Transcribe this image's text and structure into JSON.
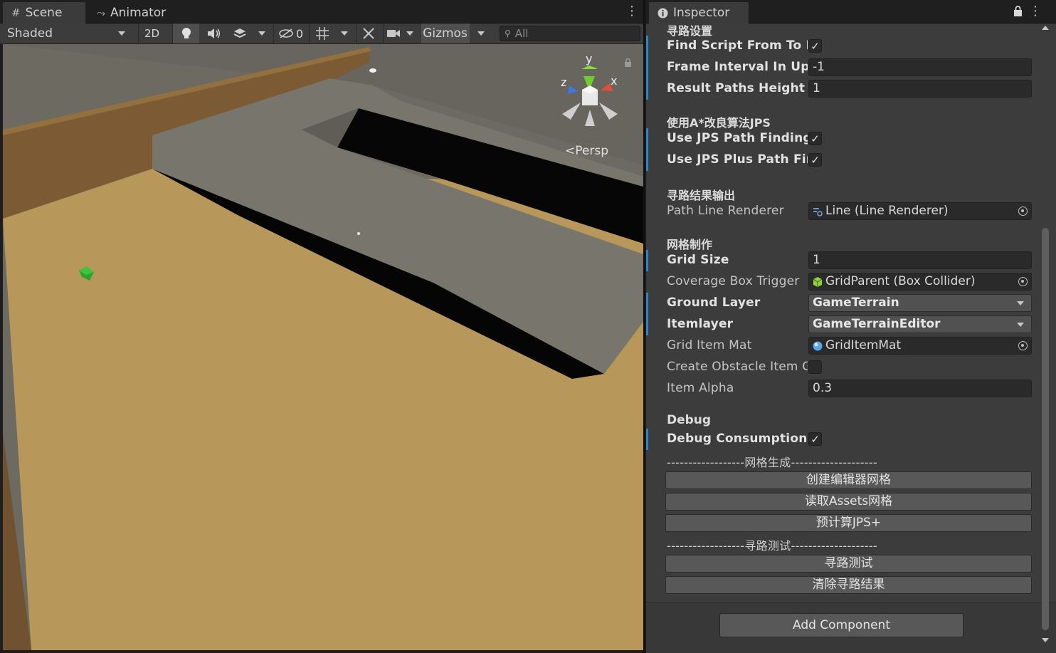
{
  "scene": {
    "tabs": [
      {
        "label": "Scene",
        "icon": "hash-icon"
      },
      {
        "label": "Animator",
        "icon": "animator-icon"
      }
    ],
    "toolbar": {
      "shading_mode": "Shaded",
      "mode_2d": "2D",
      "hidden_count": "0",
      "gizmos_label": "Gizmos",
      "search_placeholder": "All"
    },
    "gizmo": {
      "y": "y",
      "x": "x",
      "z": "z",
      "projection": "Persp"
    }
  },
  "inspector": {
    "tab_label": "Inspector",
    "sections": {
      "pathfinding_settings": "寻路设置",
      "jps": "使用A*改良算法JPS",
      "result_output": "寻路结果输出",
      "grid_making": "网格制作",
      "debug": "Debug"
    },
    "fields": {
      "find_script_label": "Find Script From To In",
      "frame_interval_label": "Frame Interval In Update",
      "frame_interval_value": "-1",
      "result_height_label": "Result Paths Height Offset",
      "result_height_value": "1",
      "use_jps_label": "Use JPS Path Finding",
      "use_jps_plus_label": "Use JPS Plus Path Finding",
      "path_line_renderer_label": "Path Line Renderer",
      "path_line_renderer_value": "Line (Line Renderer)",
      "grid_size_label": "Grid Size",
      "grid_size_value": "1",
      "coverage_box_label": "Coverage Box Trigger",
      "coverage_box_value": "GridParent (Box Collider)",
      "ground_layer_label": "Ground Layer",
      "ground_layer_value": "GameTerrain",
      "itemlayer_label": "Itemlayer",
      "itemlayer_value": "GameTerrainEditor",
      "grid_item_mat_label": "Grid Item Mat",
      "grid_item_mat_value": "GridItemMat",
      "create_obstacle_label": "Create Obstacle Item Grid",
      "item_alpha_label": "Item Alpha",
      "item_alpha_value": "0.3",
      "debug_consumption_label": "Debug Consumption Time"
    },
    "checkmark": "✓",
    "separators": {
      "grid_gen": "------------------网格生成--------------------",
      "path_test": "------------------寻路测试--------------------"
    },
    "buttons": {
      "create_editor_grid": "创建编辑器网格",
      "read_assets_grid": "读取Assets网格",
      "precompute_jps": "预计算JPS+",
      "path_test": "寻路测试",
      "clear_result": "清除寻路结果"
    },
    "add_component": "Add Component"
  },
  "colors": {
    "accent_modified": "#2f84c9",
    "ground": "#b89a55",
    "wall": "#7d5b33",
    "ramp": "#77756b",
    "cube": "#2aa52a"
  }
}
